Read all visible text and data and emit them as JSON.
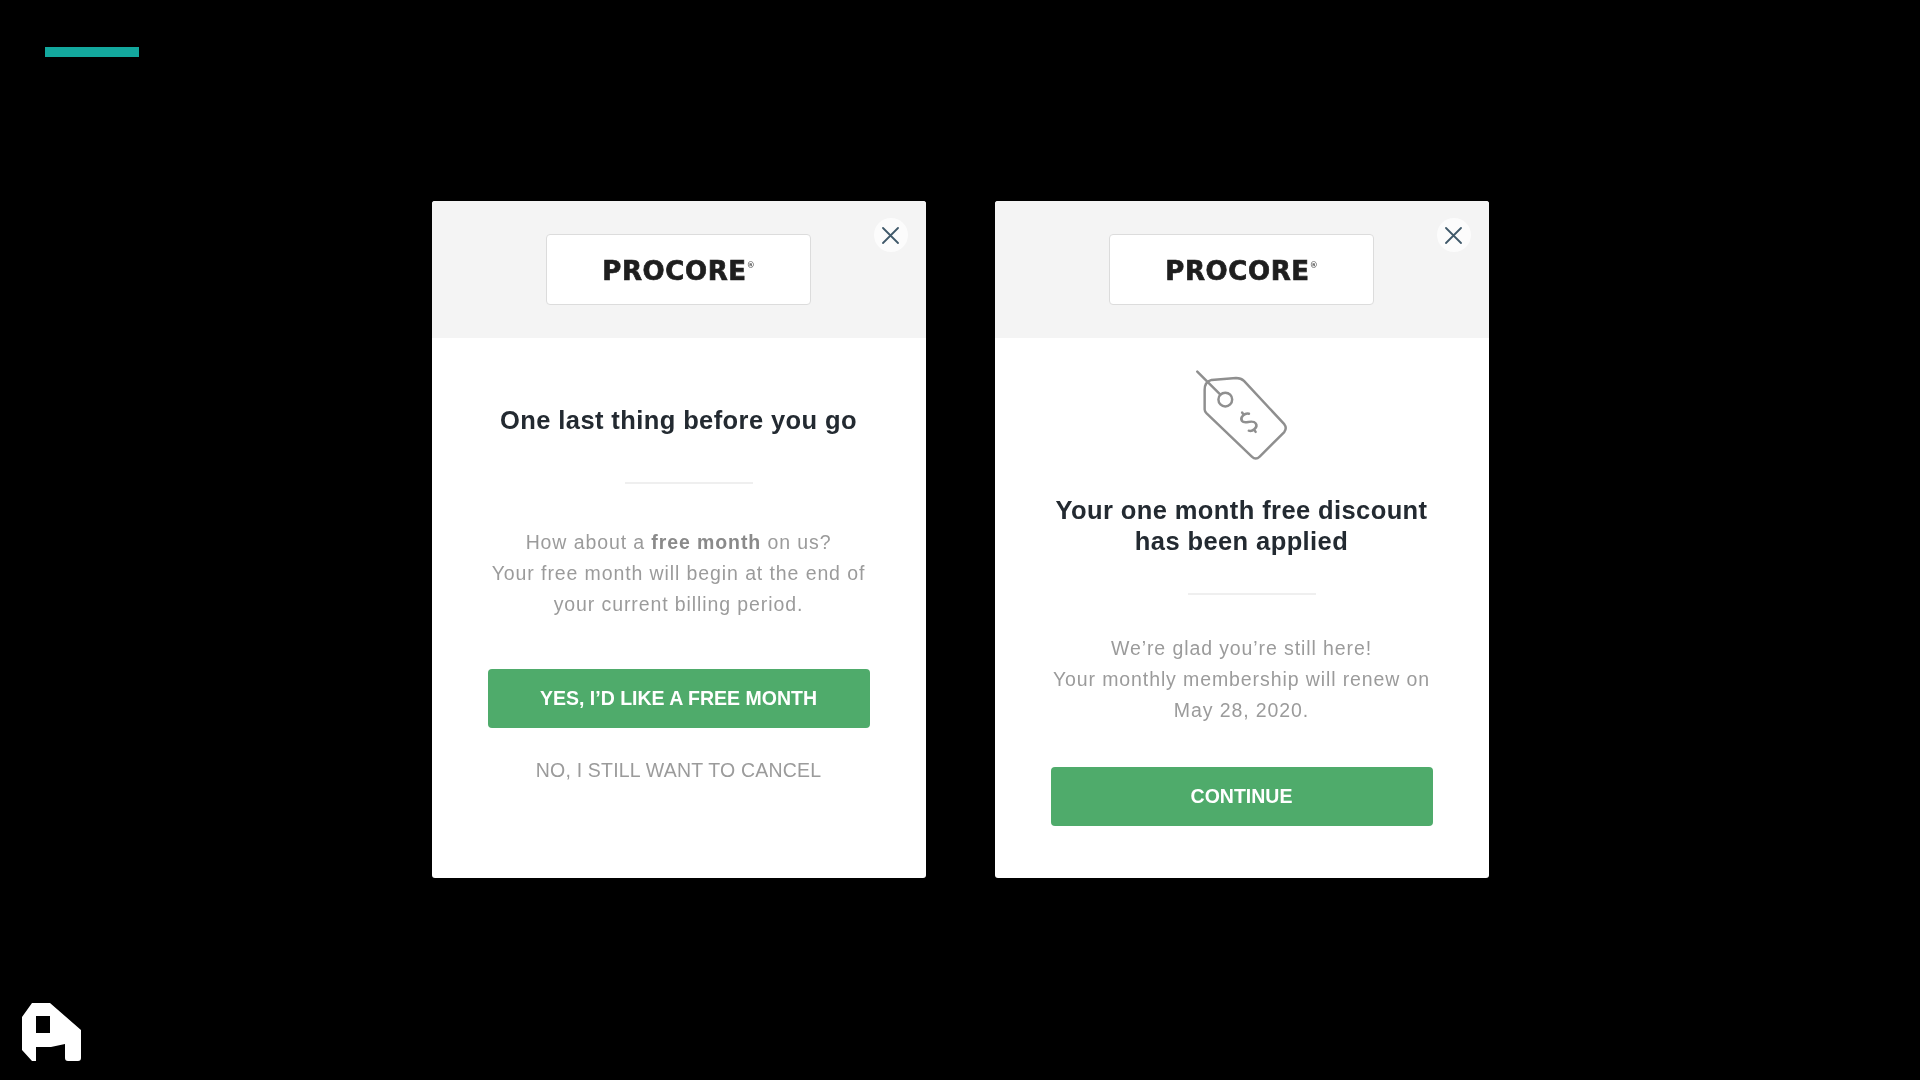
{
  "dialogs": [
    {
      "kind": "offer",
      "logo": "PROCORE$^{®}$",
      "title": "One last thing before you go",
      "message": [
        "How about a **free month** on us?",
        "Your free month will begin at the end of",
        "your current billing period."
      ],
      "primary_button": "YES, I’D LIKE A FREE MONTH",
      "secondary_link": "NO, I STILL WANT TO CANCEL"
    },
    {
      "kind": "confirmation",
      "logo": "PROCORE$^{®}$",
      "title": "Your one month free discount has been applied",
      "message": [
        "We’re glad you’re still here!",
        "Your monthly membership will renew on",
        "May 28, 2020."
      ],
      "primary_button": "CONTINUE"
    }
  ]
}
